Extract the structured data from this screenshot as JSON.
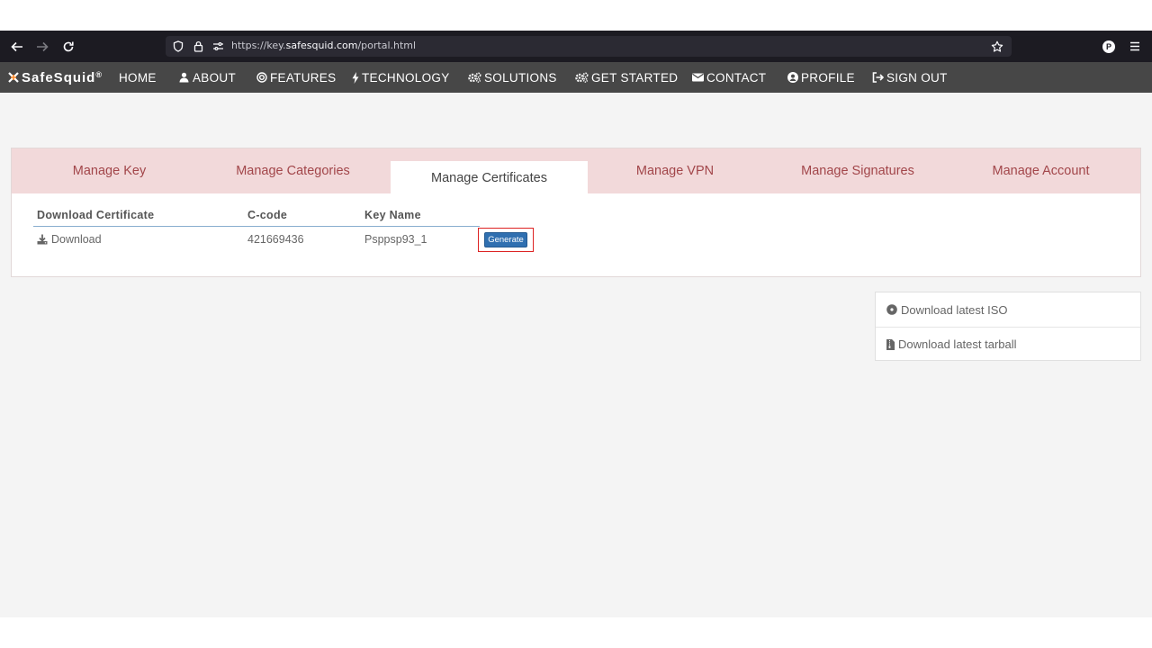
{
  "browser": {
    "url_scheme": "https://key.",
    "url_host": "safesquid.com",
    "url_path": "/portal.html",
    "profile_initial": "P"
  },
  "site_nav": {
    "brand": "SafeSquid",
    "brand_mark": "®",
    "items": [
      {
        "label": "HOME",
        "icon": ""
      },
      {
        "label": "ABOUT",
        "icon": "user-icon"
      },
      {
        "label": "FEATURES",
        "icon": "target-icon"
      },
      {
        "label": "TECHNOLOGY",
        "icon": "bolt-icon"
      },
      {
        "label": "SOLUTIONS",
        "icon": "cogs-icon"
      },
      {
        "label": "GET STARTED",
        "icon": "cogs-icon"
      },
      {
        "label": "CONTACT",
        "icon": "envelope-icon"
      },
      {
        "label": "PROFILE",
        "icon": "user-circle-icon"
      },
      {
        "label": "SIGN OUT",
        "icon": "sign-out-icon"
      }
    ]
  },
  "tabs": [
    {
      "label": "Manage Key",
      "active": false
    },
    {
      "label": "Manage Categories",
      "active": false
    },
    {
      "label": "Manage Certificates",
      "active": true
    },
    {
      "label": "Manage VPN",
      "active": false
    },
    {
      "label": "Manage Signatures",
      "active": false
    },
    {
      "label": "Manage Account",
      "active": false
    }
  ],
  "certificates": {
    "headers": [
      "Download Certificate",
      "C-code",
      "Key Name"
    ],
    "row": {
      "download_label": "Download",
      "ccode": "421669436",
      "key_name": "Psppsp93_1",
      "generate_label": "Generate"
    }
  },
  "downloads": {
    "iso_label": "Download latest ISO",
    "tarball_label": "Download latest tarball"
  },
  "colors": {
    "tab_strip": "#f2d9da",
    "tab_text": "#a2464a",
    "nav_bar": "#474747",
    "generate_button": "#2f6fb0",
    "highlight_frame": "#dd2222"
  }
}
